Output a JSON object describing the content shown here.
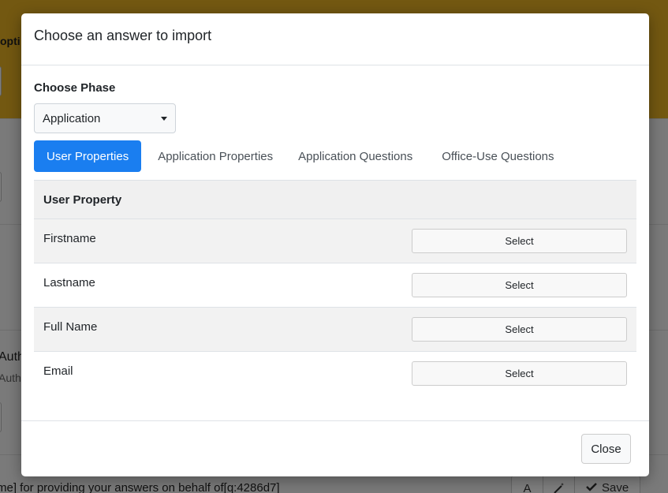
{
  "background": {
    "header_text": "opti",
    "auth_heading": "Auth",
    "auth_sub": "Auth",
    "footer_text": "me] for providing your answers on behalf of[q:4286d7]",
    "toolbar": {
      "font_icon": "A",
      "save_label": "Save"
    }
  },
  "modal": {
    "title": "Choose an answer to import",
    "phase_label": "Choose Phase",
    "phase_value": "Application",
    "tabs": [
      {
        "label": "User Properties",
        "active": true
      },
      {
        "label": "Application Properties",
        "active": false
      },
      {
        "label": "Application Questions",
        "active": false
      },
      {
        "label": "Office-Use Questions",
        "active": false
      }
    ],
    "table": {
      "header": "User Property",
      "rows": [
        {
          "name": "Firstname",
          "action": "Select"
        },
        {
          "name": "Lastname",
          "action": "Select"
        },
        {
          "name": "Full Name",
          "action": "Select"
        },
        {
          "name": "Email",
          "action": "Select"
        }
      ]
    },
    "close_label": "Close"
  },
  "colors": {
    "primary": "#1a7ef0",
    "header_bg": "#e6b022"
  }
}
